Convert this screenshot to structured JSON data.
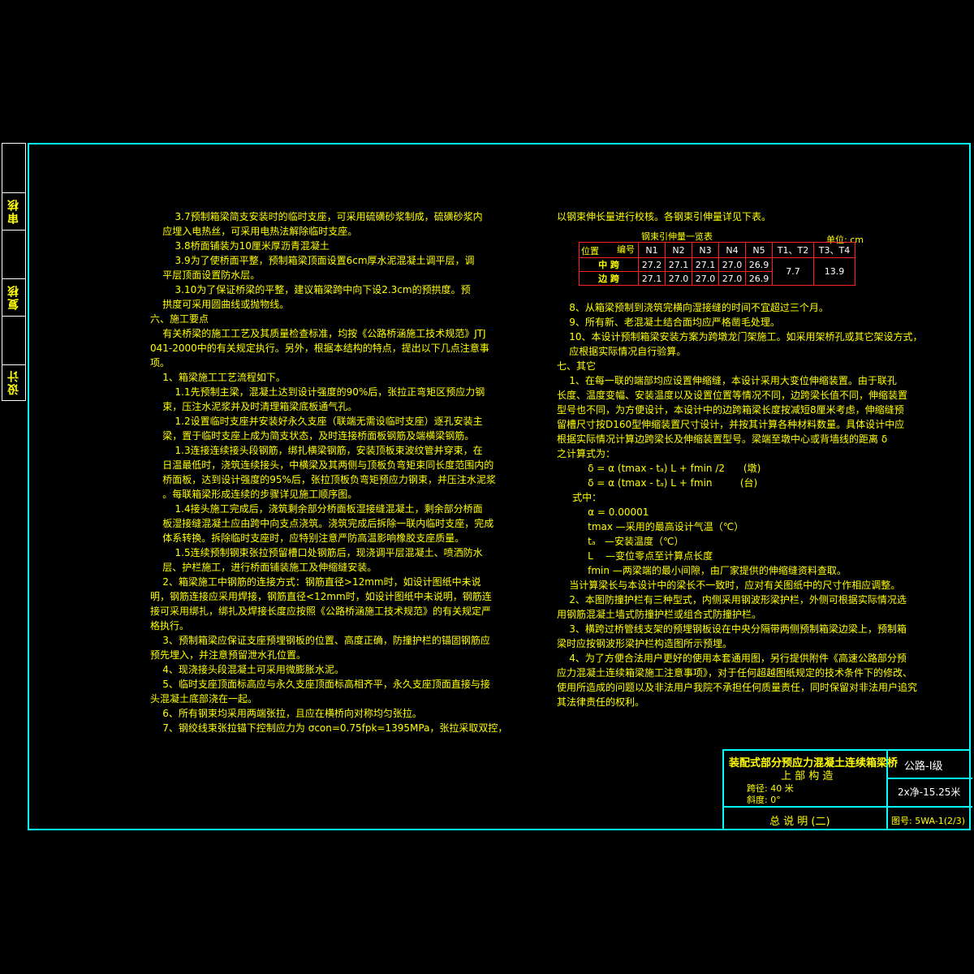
{
  "sidebar": {
    "labels": [
      "审核",
      "复核",
      "设计"
    ]
  },
  "left_column": [
    "        3.7预制箱梁简支安装时的临时支座，可采用硫磺砂浆制成，硫磺砂浆内",
    "    应埋入电热丝，可采用电热法解除临时支座。",
    "        3.8桥面铺装为10厘米厚沥青混凝土",
    "        3.9为了使桥面平整，预制箱梁顶面设置6cm厚水泥混凝土调平层，调",
    "    平层顶面设置防水层。",
    "        3.10为了保证桥梁的平整，建议箱梁跨中向下设2.3cm的预拱度。预",
    "    拱度可采用圆曲线或抛物线。",
    "六、施工要点",
    "    有关桥梁的施工工艺及其质量检查标准，均按《公路桥涵施工技术规范》JTJ",
    "041-2000中的有关规定执行。另外，根据本结构的特点，提出以下几点注意事",
    "项。",
    "    1、箱梁施工工艺流程如下。",
    "        1.1先预制主梁，混凝土达到设计强度的90%后，张拉正弯矩区预应力钢",
    "    束，压注水泥浆并及时清理箱梁底板通气孔。",
    "        1.2设置临时支座并安装好永久支座（联端无需设临时支座）逐孔安装主",
    "    梁，置于临时支座上成为简支状态，及时连接桥面板钢筋及端横梁钢筋。",
    "        1.3连接连续接头段钢筋，绑扎横梁钢筋，安装顶板束波纹管并穿束，在",
    "    日温最低时，浇筑连续接头，中横梁及其两侧与顶板负弯矩束同长度范围内的",
    "    桥面板，达到设计强度的95%后，张拉顶板负弯矩预应力钢束，并压注水泥浆",
    "    。每联箱梁形成连续的步骤详见施工顺序图。",
    "        1.4接头施工完成后，浇筑剩余部分桥面板湿接缝混凝土，剩余部分桥面",
    "    板湿接缝混凝土应由跨中向支点浇筑。浇筑完成后拆除一联内临时支座，完成",
    "    体系转换。拆除临时支座时，应特别注意严防高温影响橡胶支座质量。",
    "        1.5连续预制钢束张拉预留槽口处钢筋后，现浇调平层混凝土、喷洒防水",
    "    层、护栏施工，进行桥面铺装施工及伸缩缝安装。",
    "    2、箱梁施工中钢筋的连接方式：钢筋直径>12mm时，如设计图纸中未说",
    "明，钢筋连接应采用焊接，钢筋直径<12mm时，如设计图纸中未说明，钢筋连",
    "接可采用绑扎，绑扎及焊接长度应按照《公路桥涵施工技术规范》的有关规定严",
    "格执行。",
    "    3、预制箱梁应保证支座预埋钢板的位置、高度正确，防撞护栏的锚固钢筋应",
    "预先埋入，并注意预留泄水孔位置。",
    "    4、现浇接头段混凝土可采用微膨胀水泥。",
    "    5、临时支座顶面标高应与永久支座顶面标高相齐平，永久支座顶面直接与接",
    "头混凝土底部浇在一起。",
    "    6、所有钢束均采用两端张拉，且应在横桥向对称均匀张拉。",
    "    7、钢绞线束张拉锚下控制应力为 σcon=0.75fpk=1395MPa，张拉采取双控，"
  ],
  "right_column_top": [
    "以钢束伸长量进行校核。各钢束引伸量详见下表。"
  ],
  "table": {
    "title": "钢束引伸量一览表",
    "unit": "单位: cm",
    "corner_top": "编号",
    "corner_bottom": "位置",
    "headers": [
      "N1",
      "N2",
      "N3",
      "N4",
      "N5",
      "T1、T2",
      "T3、T4"
    ],
    "rows": [
      {
        "label": "中 跨",
        "values": [
          "27.2",
          "27.1",
          "27.1",
          "27.0",
          "26.9"
        ]
      },
      {
        "label": "边 跨",
        "values": [
          "27.1",
          "27.0",
          "27.0",
          "27.0",
          "26.9"
        ]
      }
    ],
    "merged": [
      "7.7",
      "13.9"
    ]
  },
  "right_column": [
    "    8、从箱梁预制到浇筑完横向湿接缝的时间不宜超过三个月。",
    "    9、所有新、老混凝土结合面均应严格凿毛处理。",
    "    10、本设计预制箱梁安装方案为跨墩龙门架施工。如采用架桥孔或其它架设方式，",
    "    应根据实际情况自行验算。",
    "七、其它",
    "    1、在每一联的端部均应设置伸缩缝，本设计采用大变位伸缩装置。由于联孔",
    "长度、温度变幅、安装温度以及设置位置等情况不同，边跨梁长值不同，伸缩装置",
    "型号也不同，为方便设计，本设计中的边跨箱梁长度按减短8厘米考虑，伸缩缝预",
    "留槽尺寸按D160型伸缩装置尺寸设计，并按其计算各种材料数量。具体设计中应",
    "根据实际情况计算边跨梁长及伸缩装置型号。梁端至墩中心或背墙线的距离 δ",
    "之计算式为：",
    "          δ = α (tmax - tₐ) L + fmin /2      (墩)",
    "          δ = α (tmax - tₐ) L + fmin         (台)",
    "     式中：",
    "          α = 0.00001",
    "          tmax —采用的最高设计气温（℃）",
    "          tₐ   —安装温度（℃）",
    "          L    —变位零点至计算点长度",
    "          fmin —两梁端的最小间隙，由厂家提供的伸缩缝资料查取。",
    "    当计算梁长与本设计中的梁长不一致时，应对有关图纸中的尺寸作相应调整。",
    "    2、本图防撞护栏有三种型式，内侧采用钢波形梁护栏，外侧可根据实际情况选",
    "用钢筋混凝土墙式防撞护栏或组合式防撞护栏。",
    "    3、横跨过桥管线支架的预埋钢板设在中央分隔带两侧预制箱梁边梁上，预制箱",
    "梁时应按钢波形梁护栏构造图所示预埋。",
    "    4、为了方便合法用户更好的使用本套通用图，另行提供附件《高速公路部分预",
    "应力混凝土连续箱梁施工注意事项》，对于任何超越图纸规定的技术条件下的修改、",
    "使用所造成的问题以及非法用户我院不承担任何质量责任，同时保留对非法用户追究",
    "其法律责任的权利。"
  ],
  "title_block": {
    "project_line1": "装配式部分预应力混凝土连续箱梁桥",
    "project_line2": "上 部 构 造",
    "span": "跨径: 40 米",
    "skew": "斜度: 0°",
    "grade": "公路-Ⅰ级",
    "width": "2x净-15.25米",
    "drawing_title": "总 说 明 (二)",
    "drawing_no": "图号: 5WA-1(2/3)"
  },
  "colors": {
    "background": "#000000",
    "frame": "#00ffff",
    "text": "#ffff00",
    "table_border": "#ff2020",
    "table_text": "#ffffff"
  }
}
